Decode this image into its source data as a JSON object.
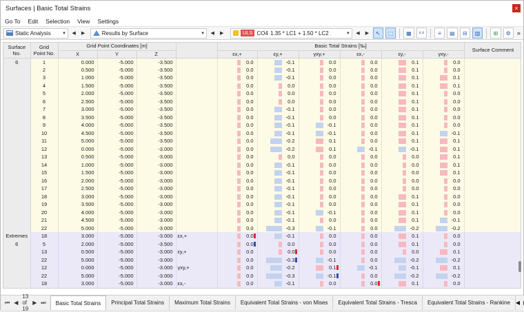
{
  "window": {
    "title": "Surfaces | Basic Total Strains",
    "close": "×"
  },
  "menu": [
    "Go To",
    "Edit",
    "Selection",
    "View",
    "Settings"
  ],
  "toolbar": {
    "analysis": "Static Analysis",
    "results": "Results by Surface",
    "uls": "ULS",
    "combo_id": "CO4",
    "combo_formula": "1.35 * LC1 + 1.50 * LC2 ...",
    "arrow_down": "▾",
    "nav_prev": "◀",
    "nav_next": "▶",
    "icons": [
      "select-icon",
      "pick-icon",
      "table-icon",
      "xxx-icon",
      "list-icon",
      "sheet-icon",
      "filter-icon",
      "layers-icon",
      "export-icon",
      "settings-icon"
    ]
  },
  "headers": {
    "surface": "Surface\nNo.",
    "grid_point": "Grid\nPoint No.",
    "coords": "Grid Point Coordinates [m]",
    "x": "X",
    "y": "Y",
    "z": "Z",
    "strains": "Basic Total Strains [‰]",
    "e_xp": "εx,+",
    "e_yp": "εy,+",
    "g_xyp": "γxy,+",
    "e_xm": "εx,-",
    "e_ym": "εy,-",
    "g_xym": "γxy,-",
    "comment": "Surface Comment"
  },
  "surface_no": "6",
  "extremes_label": "Extremes",
  "extremes_no": "6",
  "rows": [
    [
      "1",
      "0.000",
      "-5.000",
      "-3.500",
      "",
      "0.0",
      "-0.1",
      "0.0",
      "0.0",
      "0.1",
      "0.0"
    ],
    [
      "2",
      "0.500",
      "-5.000",
      "-3.500",
      "",
      "0.0",
      "-0.1",
      "0.0",
      "0.0",
      "0.1",
      "0.0"
    ],
    [
      "3",
      "1.000",
      "-5.000",
      "-3.500",
      "",
      "0.0",
      "-0.1",
      "0.0",
      "0.0",
      "0.1",
      "0.1"
    ],
    [
      "4",
      "1.500",
      "-5.000",
      "-3.500",
      "",
      "0.0",
      "0.0",
      "0.0",
      "0.0",
      "0.1",
      "0.1"
    ],
    [
      "5",
      "2.000",
      "-5.000",
      "-3.500",
      "",
      "0.0",
      "0.0",
      "0.0",
      "0.0",
      "0.1",
      "0.0"
    ],
    [
      "6",
      "2.500",
      "-5.000",
      "-3.500",
      "",
      "0.0",
      "0.0",
      "0.0",
      "0.0",
      "0.1",
      "0.0"
    ],
    [
      "7",
      "3.000",
      "-5.000",
      "-3.500",
      "",
      "0.0",
      "-0.1",
      "0.0",
      "0.0",
      "0.1",
      "0.0"
    ],
    [
      "8",
      "3.500",
      "-5.000",
      "-3.500",
      "",
      "0.0",
      "-0.1",
      "0.0",
      "0.0",
      "0.1",
      "0.0"
    ],
    [
      "9",
      "4.000",
      "-5.000",
      "-3.500",
      "",
      "0.0",
      "-0.1",
      "-0.1",
      "0.0",
      "0.1",
      "0.0"
    ],
    [
      "10",
      "4.500",
      "-5.000",
      "-3.500",
      "",
      "0.0",
      "-0.1",
      "-0.1",
      "0.0",
      "0.1",
      "-0.1"
    ],
    [
      "11",
      "5.000",
      "-5.000",
      "-3.500",
      "",
      "0.0",
      "-0.2",
      "0.1",
      "0.0",
      "0.1",
      "0.1"
    ],
    [
      "12",
      "0.000",
      "-5.000",
      "-3.000",
      "",
      "0.0",
      "-0.2",
      "0.1",
      "-0.1",
      "-0.1",
      "0.1"
    ],
    [
      "13",
      "0.500",
      "-5.000",
      "-3.000",
      "",
      "0.0",
      "0.0",
      "0.0",
      "0.0",
      "0.0",
      "0.1"
    ],
    [
      "14",
      "1.000",
      "-5.000",
      "-3.000",
      "",
      "0.0",
      "-0.1",
      "0.0",
      "0.0",
      "0.0",
      "0.1"
    ],
    [
      "15",
      "1.500",
      "-5.000",
      "-3.000",
      "",
      "0.0",
      "-0.1",
      "0.0",
      "0.0",
      "0.0",
      "0.1"
    ],
    [
      "16",
      "2.000",
      "-5.000",
      "-3.000",
      "",
      "0.0",
      "-0.1",
      "0.0",
      "0.0",
      "0.0",
      "0.0"
    ],
    [
      "17",
      "2.500",
      "-5.000",
      "-3.000",
      "",
      "0.0",
      "-0.1",
      "0.0",
      "0.0",
      "0.0",
      "0.0"
    ],
    [
      "18",
      "3.000",
      "-5.000",
      "-3.000",
      "",
      "0.0",
      "-0.1",
      "0.0",
      "0.0",
      "0.1",
      "0.0"
    ],
    [
      "19",
      "3.500",
      "-5.000",
      "-3.000",
      "",
      "0.0",
      "-0.1",
      "0.0",
      "0.0",
      "0.1",
      "0.0"
    ],
    [
      "20",
      "4.000",
      "-5.000",
      "-3.000",
      "",
      "0.0",
      "-0.1",
      "-0.1",
      "0.0",
      "0.1",
      "0.0"
    ],
    [
      "21",
      "4.500",
      "-5.000",
      "-3.000",
      "",
      "0.0",
      "-0.1",
      "0.0",
      "0.0",
      "0.1",
      "-0.1"
    ],
    [
      "22",
      "5.000",
      "-5.000",
      "-3.000",
      "",
      "0.0",
      "-0.3",
      "-0.1",
      "0.0",
      "-0.2",
      "-0.2"
    ]
  ],
  "extreme_rows": [
    [
      "18",
      "3.000",
      "-5.000",
      "-3.000",
      "εx,+",
      "0.0",
      "-0.1",
      "0.0",
      "0.0",
      "0.1",
      "0.0"
    ],
    [
      "5",
      "2.000",
      "-5.000",
      "-3.500",
      "",
      "0.0",
      "0.0",
      "0.0",
      "0.0",
      "0.1",
      "0.0"
    ],
    [
      "13",
      "0.500",
      "-5.000",
      "-3.000",
      "εy,+",
      "0.0",
      "0.0",
      "0.0",
      "0.0",
      "0.0",
      "0.1"
    ],
    [
      "22",
      "5.000",
      "-5.000",
      "-3.000",
      "",
      "0.0",
      "-0.3",
      "-0.1",
      "0.0",
      "-0.2",
      "-0.2"
    ],
    [
      "12",
      "0.000",
      "-5.000",
      "-3.000",
      "γxy,+",
      "0.0",
      "-0.2",
      "0.1",
      "-0.1",
      "-0.1",
      "0.1"
    ],
    [
      "22",
      "5.000",
      "-5.000",
      "-3.000",
      "",
      "0.0",
      "-0.3",
      "-0.1",
      "0.0",
      "-0.2",
      "-0.2"
    ],
    [
      "18",
      "3.000",
      "-5.000",
      "-3.000",
      "εx,-",
      "0.0",
      "-0.1",
      "0.0",
      "0.0",
      "0.1",
      "0.0"
    ]
  ],
  "pager": {
    "first": "⏮",
    "prev": "◀",
    "text": "13 of 19",
    "next": "▶",
    "last": "⏭"
  },
  "tabs": [
    "Basic Total Strains",
    "Principal Total Strains",
    "Maximum Total Strains",
    "Equivalent Total Strains - von Mises",
    "Equivalent Total Strains - Tresca",
    "Equivalent Total Strains - Rankine"
  ],
  "colors": {
    "row_bg": "#fdfbe6",
    "extremes_bg": "#ebe9f8",
    "positive_bar": "#f7b9bf",
    "negative_bar": "#c3d3ef",
    "marker_red": "#d9302b",
    "marker_blue": "#2d4fb3"
  }
}
